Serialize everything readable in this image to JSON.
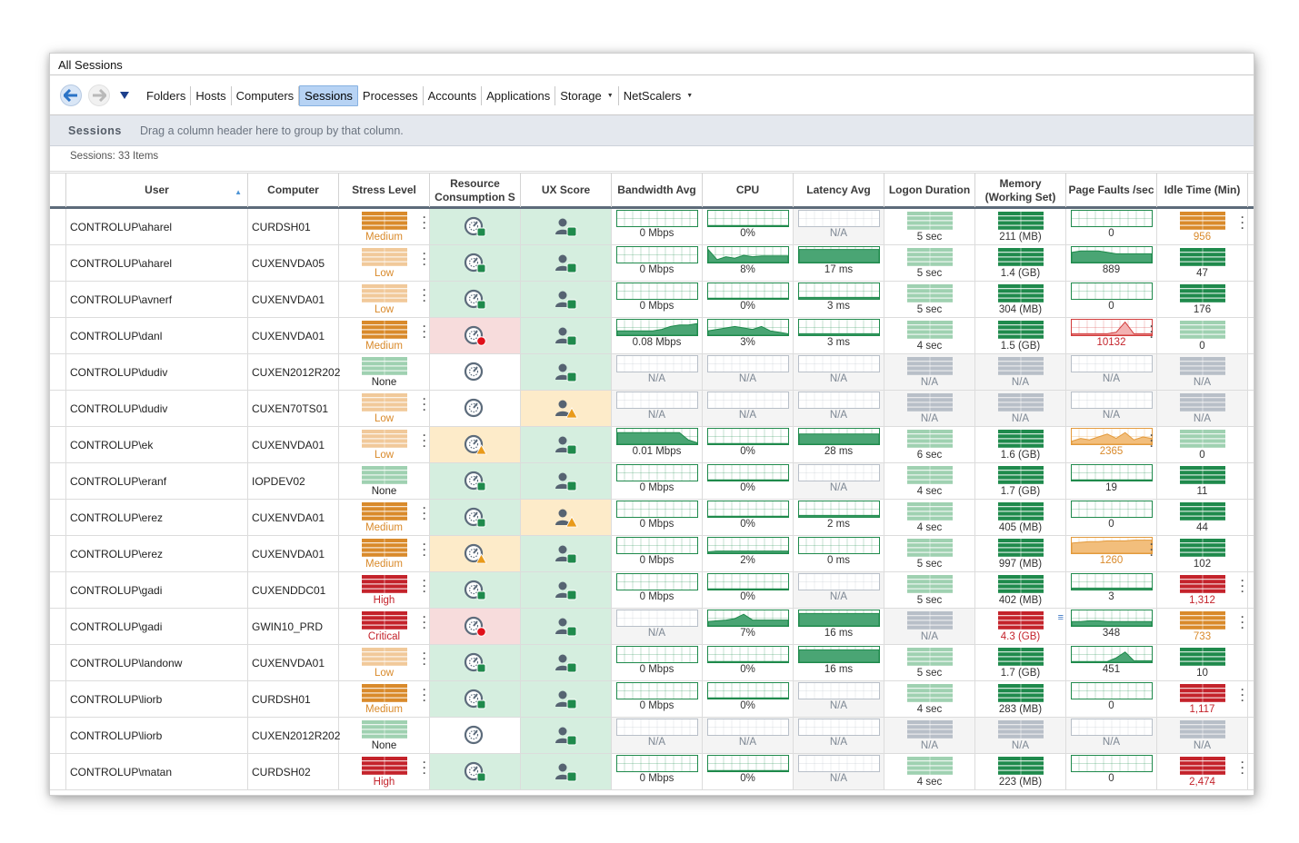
{
  "window": {
    "title": "All Sessions"
  },
  "nav": {
    "items": [
      {
        "label": "Folders",
        "active": false,
        "caret": false
      },
      {
        "label": "Hosts",
        "active": false,
        "caret": false
      },
      {
        "label": "Computers",
        "active": false,
        "caret": false
      },
      {
        "label": "Sessions",
        "active": true,
        "caret": false
      },
      {
        "label": "Processes",
        "active": false,
        "caret": false
      },
      {
        "label": "Accounts",
        "active": false,
        "caret": false
      },
      {
        "label": "Applications",
        "active": false,
        "caret": false
      },
      {
        "label": "Storage",
        "active": false,
        "caret": true
      },
      {
        "label": "NetScalers",
        "active": false,
        "caret": true
      }
    ],
    "icons": {
      "back": "arrow-left-icon",
      "forward": "arrow-right-icon",
      "dropdown": "triangle-down-icon"
    }
  },
  "group_bar": {
    "title": "Sessions",
    "hint": "Drag a column header here to group by that column."
  },
  "count_text": "Sessions: 33 Items",
  "columns": [
    {
      "key": "user",
      "label": "User",
      "sorted": "asc"
    },
    {
      "key": "computer",
      "label": "Computer"
    },
    {
      "key": "stress",
      "label": "Stress Level"
    },
    {
      "key": "resource",
      "label": "Resource Consumption S"
    },
    {
      "key": "ux",
      "label": "UX Score"
    },
    {
      "key": "bandwidth",
      "label": "Bandwidth Avg"
    },
    {
      "key": "cpu",
      "label": "CPU"
    },
    {
      "key": "latency",
      "label": "Latency Avg"
    },
    {
      "key": "logon",
      "label": "Logon Duration"
    },
    {
      "key": "memory",
      "label": "Memory (Working Set)"
    },
    {
      "key": "pagefaults",
      "label": "Page Faults /sec"
    },
    {
      "key": "idle",
      "label": "Idle Time (Min)"
    }
  ],
  "colors": {
    "green": "#1f8a4c",
    "light_green": "#9fd1b1",
    "orange": "#d98a2b",
    "light_orange": "#f1c99a",
    "red": "#c4232b",
    "gray": "#b8bfc8",
    "cell_green": "#d5eedf",
    "cell_red": "#f7dcdc",
    "cell_orange": "#fdebc9",
    "accent_blue": "#2a73c6"
  },
  "rows": [
    {
      "user": "CONTROLUP\\aharel",
      "computer": "CURDSH01",
      "stress": "Medium",
      "resource": "ok",
      "ux": "ok",
      "bandwidth": "0 Mbps",
      "cpu": "0%",
      "latency": "N/A",
      "logon": "5 sec",
      "memory": "211 (MB)",
      "pagefaults": "0",
      "idle": "956"
    },
    {
      "user": "CONTROLUP\\aharel",
      "computer": "CUXENVDA05",
      "stress": "Low",
      "resource": "ok",
      "ux": "ok",
      "bandwidth": "0 Mbps",
      "cpu": "8%",
      "latency": "17 ms",
      "logon": "5 sec",
      "memory": "1.4 (GB)",
      "pagefaults": "889",
      "idle": "47"
    },
    {
      "user": "CONTROLUP\\avnerf",
      "computer": "CUXENVDA01",
      "stress": "Low",
      "resource": "ok",
      "ux": "ok",
      "bandwidth": "0 Mbps",
      "cpu": "0%",
      "latency": "3 ms",
      "logon": "5 sec",
      "memory": "304 (MB)",
      "pagefaults": "0",
      "idle": "176"
    },
    {
      "user": "CONTROLUP\\danl",
      "computer": "CUXENVDA01",
      "stress": "Medium",
      "resource": "critical",
      "ux": "ok",
      "bandwidth": "0.08 Mbps",
      "cpu": "3%",
      "latency": "3 ms",
      "logon": "4 sec",
      "memory": "1.5 (GB)",
      "pagefaults": "10132",
      "idle": "0"
    },
    {
      "user": "CONTROLUP\\dudiv",
      "computer": "CUXEN2012R202",
      "stress": "None",
      "resource": "na",
      "ux": "ok",
      "bandwidth": "N/A",
      "cpu": "N/A",
      "latency": "N/A",
      "logon": "N/A",
      "memory": "N/A",
      "pagefaults": "N/A",
      "idle": "N/A"
    },
    {
      "user": "CONTROLUP\\dudiv",
      "computer": "CUXEN70TS01",
      "stress": "Low",
      "resource": "na",
      "ux": "warn",
      "bandwidth": "N/A",
      "cpu": "N/A",
      "latency": "N/A",
      "logon": "N/A",
      "memory": "N/A",
      "pagefaults": "N/A",
      "idle": "N/A"
    },
    {
      "user": "CONTROLUP\\ek",
      "computer": "CUXENVDA01",
      "stress": "Low",
      "resource": "warn",
      "ux": "ok",
      "bandwidth": "0.01 Mbps",
      "cpu": "0%",
      "latency": "28 ms",
      "logon": "6 sec",
      "memory": "1.6 (GB)",
      "pagefaults": "2365",
      "idle": "0"
    },
    {
      "user": "CONTROLUP\\eranf",
      "computer": "IOPDEV02",
      "stress": "None",
      "resource": "ok",
      "ux": "ok",
      "bandwidth": "0 Mbps",
      "cpu": "0%",
      "latency": "N/A",
      "logon": "4 sec",
      "memory": "1.7 (GB)",
      "pagefaults": "19",
      "idle": "11"
    },
    {
      "user": "CONTROLUP\\erez",
      "computer": "CUXENVDA01",
      "stress": "Medium",
      "resource": "ok",
      "ux": "warn",
      "bandwidth": "0 Mbps",
      "cpu": "0%",
      "latency": "2 ms",
      "logon": "4 sec",
      "memory": "405 (MB)",
      "pagefaults": "0",
      "idle": "44"
    },
    {
      "user": "CONTROLUP\\erez",
      "computer": "CUXENVDA01",
      "stress": "Medium",
      "resource": "warn",
      "ux": "ok",
      "bandwidth": "0 Mbps",
      "cpu": "2%",
      "latency": "0 ms",
      "logon": "5 sec",
      "memory": "997 (MB)",
      "pagefaults": "1260",
      "idle": "102"
    },
    {
      "user": "CONTROLUP\\gadi",
      "computer": "CUXENDDC01",
      "stress": "High",
      "resource": "ok",
      "ux": "ok",
      "bandwidth": "0 Mbps",
      "cpu": "0%",
      "latency": "N/A",
      "logon": "5 sec",
      "memory": "402 (MB)",
      "pagefaults": "3",
      "idle": "1,312"
    },
    {
      "user": "CONTROLUP\\gadi",
      "computer": "GWIN10_PRD",
      "stress": "Critical",
      "resource": "critical",
      "ux": "ok",
      "bandwidth": "N/A",
      "cpu": "7%",
      "latency": "16 ms",
      "logon": "N/A",
      "memory": "4.3 (GB)",
      "pagefaults": "348",
      "idle": "733"
    },
    {
      "user": "CONTROLUP\\landonw",
      "computer": "CUXENVDA01",
      "stress": "Low",
      "resource": "ok",
      "ux": "ok",
      "bandwidth": "0 Mbps",
      "cpu": "0%",
      "latency": "16 ms",
      "logon": "5 sec",
      "memory": "1.7 (GB)",
      "pagefaults": "451",
      "idle": "10"
    },
    {
      "user": "CONTROLUP\\liorb",
      "computer": "CURDSH01",
      "stress": "Medium",
      "resource": "ok",
      "ux": "ok",
      "bandwidth": "0 Mbps",
      "cpu": "0%",
      "latency": "N/A",
      "logon": "4 sec",
      "memory": "283 (MB)",
      "pagefaults": "0",
      "idle": "1,117"
    },
    {
      "user": "CONTROLUP\\liorb",
      "computer": "CUXEN2012R202",
      "stress": "None",
      "resource": "na",
      "ux": "ok",
      "bandwidth": "N/A",
      "cpu": "N/A",
      "latency": "N/A",
      "logon": "N/A",
      "memory": "N/A",
      "pagefaults": "N/A",
      "idle": "N/A"
    },
    {
      "user": "CONTROLUP\\matan",
      "computer": "CURDSH02",
      "stress": "High",
      "resource": "ok",
      "ux": "ok",
      "bandwidth": "0 Mbps",
      "cpu": "0%",
      "latency": "N/A",
      "logon": "4 sec",
      "memory": "223 (MB)",
      "pagefaults": "0",
      "idle": "2,474"
    }
  ]
}
